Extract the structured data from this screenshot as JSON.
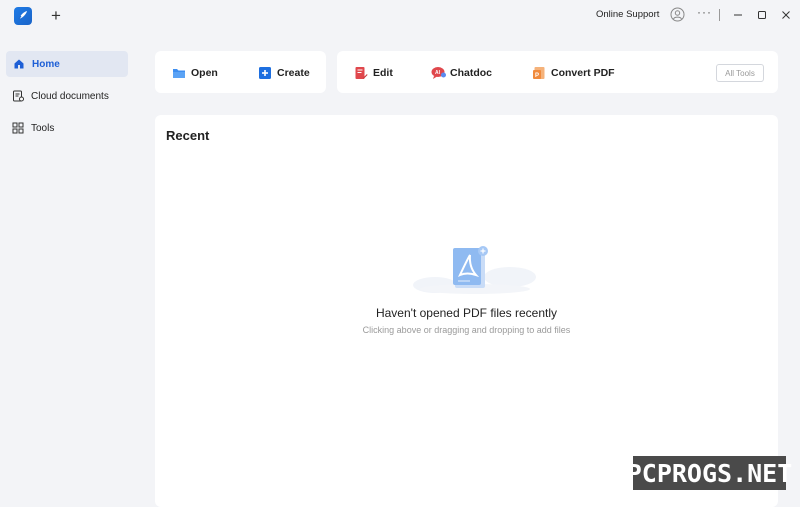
{
  "titlebar": {
    "new_tab_symbol": "+",
    "online_support_label": "Online Support",
    "more_symbol": "···"
  },
  "sidebar": {
    "items": [
      {
        "label": "Home",
        "icon": "home-icon",
        "active": true
      },
      {
        "label": "Cloud documents",
        "icon": "cloud-documents-icon",
        "active": false
      },
      {
        "label": "Tools",
        "icon": "tools-grid-icon",
        "active": false
      }
    ]
  },
  "actions": {
    "open_label": "Open",
    "create_label": "Create",
    "edit_label": "Edit",
    "chatdoc_label": "Chatdoc",
    "convert_label": "Convert PDF",
    "all_tools_label": "All Tools"
  },
  "recent": {
    "title": "Recent",
    "empty_title": "Haven't opened PDF files recently",
    "empty_hint": "Clicking above or dragging and dropping to add files"
  },
  "watermark": {
    "text": "PCPROGS.NET"
  },
  "colors": {
    "accent": "#1e5fd6",
    "background": "#f3f4f7",
    "card": "#ffffff",
    "edit_red": "#e0474c",
    "convert_orange": "#f08a3c"
  }
}
